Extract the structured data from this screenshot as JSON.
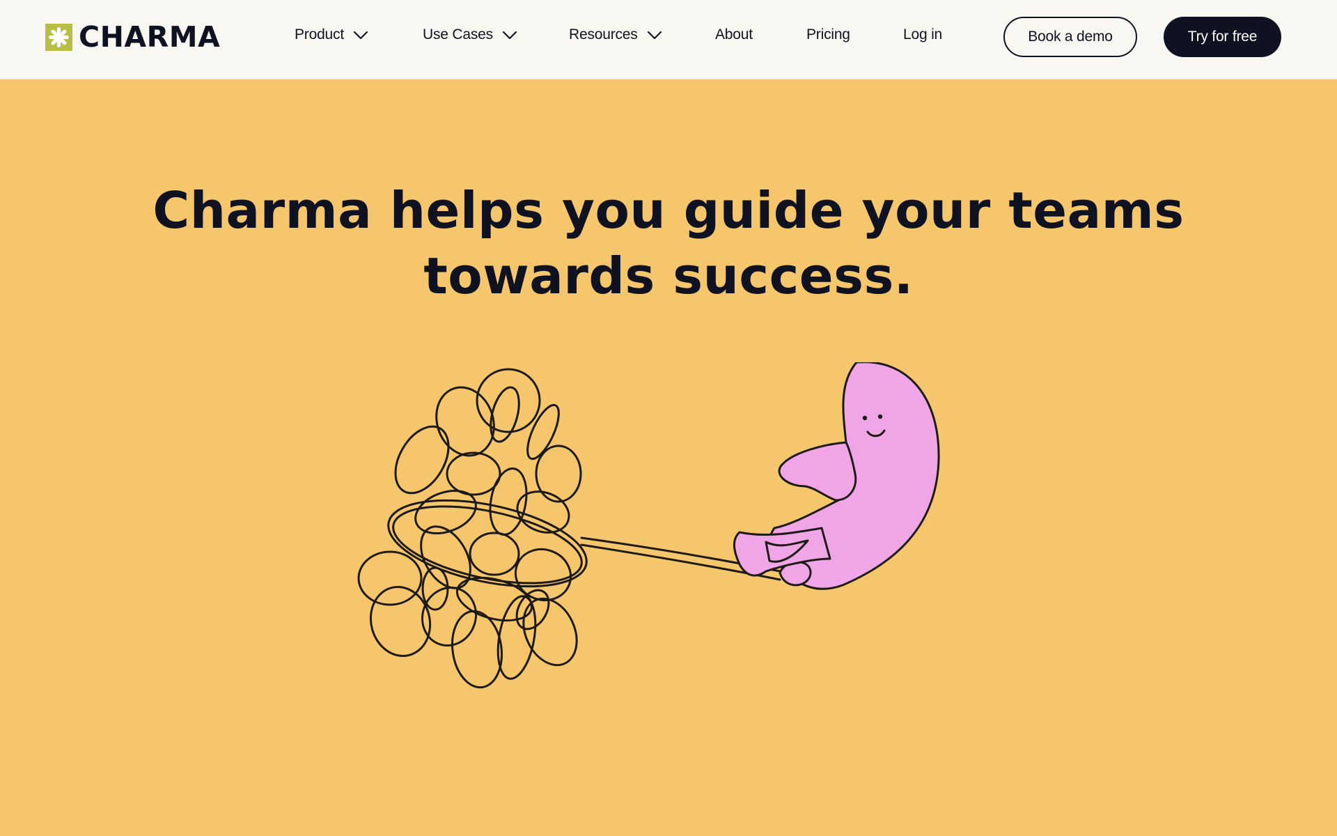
{
  "brand": {
    "name": "CHARMA",
    "logo_color": "#b8bd45"
  },
  "nav": {
    "items": [
      {
        "label": "Product",
        "has_dropdown": true
      },
      {
        "label": "Use Cases",
        "has_dropdown": true
      },
      {
        "label": "Resources",
        "has_dropdown": true
      },
      {
        "label": "About",
        "has_dropdown": false
      },
      {
        "label": "Pricing",
        "has_dropdown": false
      },
      {
        "label": "Log in",
        "has_dropdown": false
      }
    ],
    "icons": {
      "dropdown": "chevron-down-icon"
    }
  },
  "actions": {
    "book_demo": "Book a demo",
    "try_free": "Try for free"
  },
  "hero": {
    "title_line1": "Charma helps you guide your teams",
    "title_line2": "towards success.",
    "illustration": "pink-character-pulling-tangled-yarn"
  },
  "colors": {
    "header_bg": "#f8f7f2",
    "hero_bg": "#f6c66d",
    "dark": "#0f1220",
    "character_pink": "#f0a6e6"
  }
}
